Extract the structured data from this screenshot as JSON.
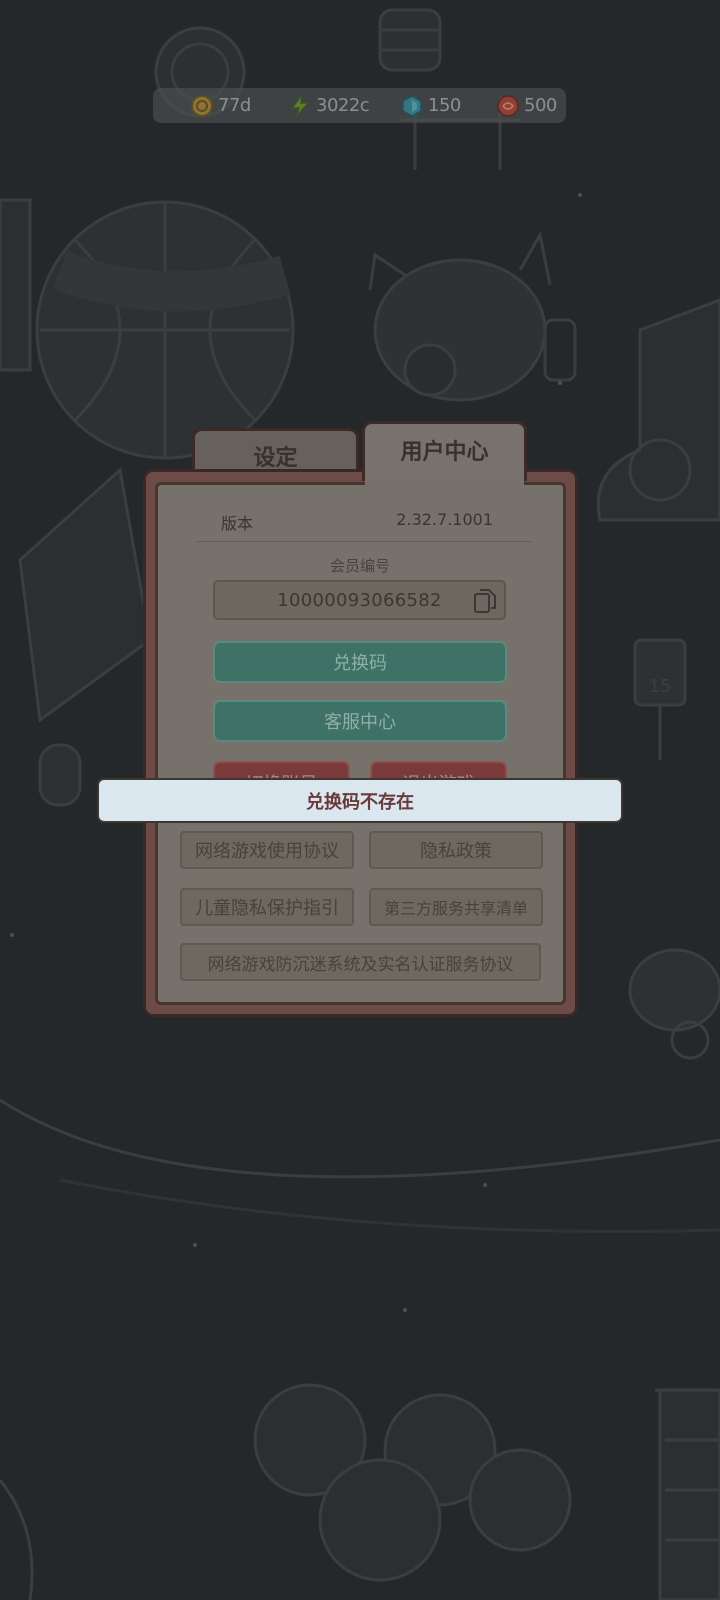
{
  "resources": [
    {
      "icon": "coin-icon",
      "value": "77d",
      "color": "#b8953a"
    },
    {
      "icon": "lightning-icon",
      "value": "3022c",
      "color": "#6f9a3a"
    },
    {
      "icon": "gem-icon",
      "value": "150",
      "color": "#3f8f9a"
    },
    {
      "icon": "food-icon",
      "value": "500",
      "color": "#b04a3a"
    }
  ],
  "tabs": [
    {
      "label": "设定",
      "active": false
    },
    {
      "label": "用户中心",
      "active": true
    }
  ],
  "version": {
    "label": "版本",
    "value": "2.32.7.1001"
  },
  "member": {
    "label": "会员编号",
    "id": "10000093066582"
  },
  "buttons": {
    "redeem": "兑换码",
    "support": "客服中心",
    "switch_account": "切换账号",
    "exit_game": "退出游戏"
  },
  "links": [
    "网络游戏使用协议",
    "隐私政策",
    "儿童隐私保护指引",
    "第三方服务共享清单",
    "网络游戏防沉迷系统及实名认证服务协议"
  ],
  "toast": {
    "message": "兑换码不存在"
  },
  "scene": {
    "signpost_number": "15"
  },
  "colors": {
    "background": "#25282b",
    "panel": "#76726b",
    "panel_frame": "#6d4b46",
    "green_button": "#3f7266",
    "red_button": "#7a3a3a",
    "toast_bg": "#dbe7ef",
    "toast_text": "#6a3a38"
  }
}
